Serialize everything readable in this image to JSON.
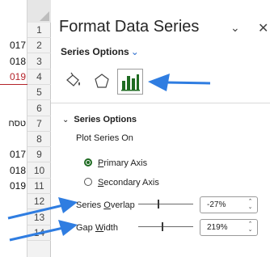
{
  "sheet": {
    "row_numbers": [
      "1",
      "2",
      "3",
      "4",
      "5",
      "6",
      "7",
      "8",
      "9",
      "10",
      "11",
      "12",
      "13",
      "14"
    ],
    "cells": [
      {
        "row": 2,
        "text": "017",
        "style": "normal"
      },
      {
        "row": 3,
        "text": "018",
        "style": "normal"
      },
      {
        "row": 4,
        "text": "019",
        "style": "red"
      },
      {
        "row": 7,
        "text": "טסח",
        "style": "hebrew"
      },
      {
        "row": 9,
        "text": "017",
        "style": "normal"
      },
      {
        "row": 10,
        "text": "018",
        "style": "normal"
      },
      {
        "row": 11,
        "text": "019",
        "style": "normal"
      }
    ]
  },
  "pane": {
    "title": "Format Data Series",
    "dropdown_icon": "chevron-down-icon",
    "close_icon": "close-icon",
    "options_tab_label": "Series Options",
    "icons": [
      "paint-bucket-icon",
      "pentagon-effects-icon",
      "bar-chart-icon"
    ],
    "section": {
      "title": "Series Options",
      "plot_label": "Plot Series On",
      "primary_axis": {
        "prefix": "",
        "underline": "P",
        "rest": "rimary Axis",
        "selected": true
      },
      "secondary_axis": {
        "prefix": "",
        "underline": "S",
        "rest": "econdary Axis",
        "selected": false
      },
      "overlap": {
        "prefix": "Series ",
        "underline": "O",
        "rest": "verlap",
        "value": "-27%",
        "level": -27
      },
      "gap": {
        "prefix": "Gap ",
        "underline": "W",
        "rest": "idth",
        "value": "219%",
        "level": 219
      }
    },
    "accent_color": "#1f6b22",
    "annotation_color": "#2f7de1"
  }
}
